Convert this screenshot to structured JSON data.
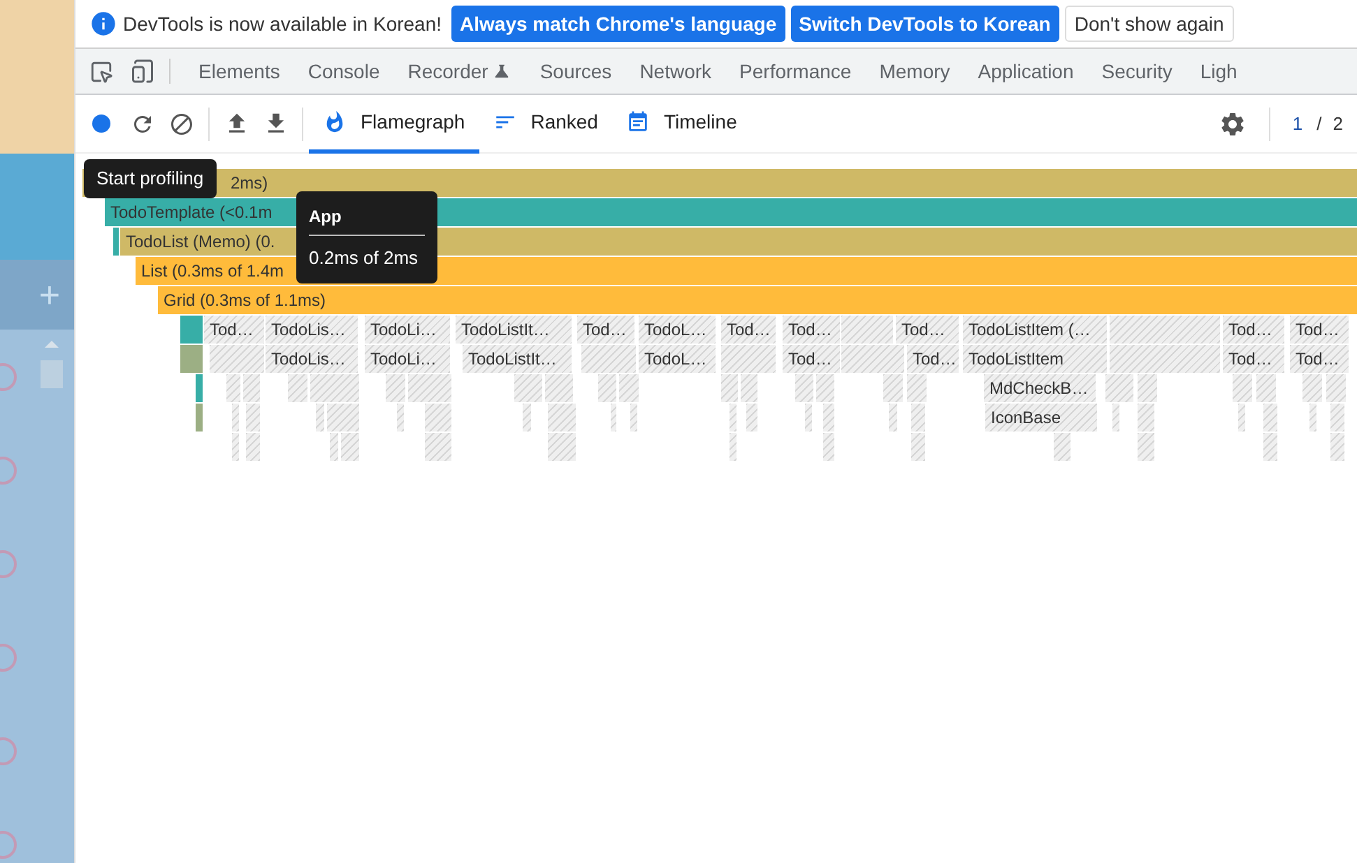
{
  "banner": {
    "message": "DevTools is now available in Korean!",
    "buttons": [
      {
        "label": "Always match Chrome's language",
        "kind": "primary"
      },
      {
        "label": "Switch DevTools to Korean",
        "kind": "primary"
      },
      {
        "label": "Don't show again",
        "kind": "secondary"
      }
    ]
  },
  "devtools_tabs": [
    {
      "label": "Elements",
      "experimental": false
    },
    {
      "label": "Console",
      "experimental": false
    },
    {
      "label": "Recorder",
      "experimental": true
    },
    {
      "label": "Sources",
      "experimental": false
    },
    {
      "label": "Network",
      "experimental": false
    },
    {
      "label": "Performance",
      "experimental": false
    },
    {
      "label": "Memory",
      "experimental": false
    },
    {
      "label": "Application",
      "experimental": false
    },
    {
      "label": "Security",
      "experimental": false
    },
    {
      "label": "Ligh",
      "experimental": false
    }
  ],
  "profiler_toolbar": {
    "recording": false,
    "tabs": [
      {
        "label": "Flamegraph",
        "selected": true
      },
      {
        "label": "Ranked",
        "selected": false
      },
      {
        "label": "Timeline",
        "selected": false
      }
    ],
    "commit_index": "1",
    "commit_separator": "/",
    "commit_total": "2"
  },
  "page_sidebar": {
    "add_label": "+"
  },
  "flamegraph": {
    "rows": [
      {
        "nodes": [
          {
            "label": "2ms)",
            "color": "#cfb966"
          }
        ]
      },
      {
        "nodes": [
          {
            "label": "TodoTemplate (<0.1m",
            "color": "#37aea7"
          }
        ]
      },
      {
        "nodes": [
          {
            "color": "#37aea7"
          },
          {
            "label": "TodoList (Memo) (0.",
            "color": "#cfb966"
          }
        ]
      },
      {
        "nodes": [
          {
            "label": "List (0.3ms of 1.4m",
            "color": "#ffbb3b"
          }
        ]
      },
      {
        "nodes": [
          {
            "label": "Grid (0.3ms of 1.1ms)",
            "color": "#ffbb3b"
          }
        ]
      },
      {
        "nodes": [
          {
            "color": "#37aea7"
          },
          {
            "label": "Tod…",
            "color": "#eeeeee"
          },
          {
            "label": "TodoLis…",
            "color": "#eeeeee"
          },
          {
            "label": "TodoLi…",
            "color": "#eeeeee"
          },
          {
            "label": "TodoListIt…",
            "color": "#eeeeee"
          },
          {
            "label": "Tod…",
            "color": "#eeeeee"
          },
          {
            "label": "TodoL…",
            "color": "#eeeeee"
          },
          {
            "label": "Tod…",
            "color": "#eeeeee"
          },
          {
            "label": "Tod…",
            "color": "#eeeeee"
          },
          {
            "label": "Tod…",
            "color": "#eeeeee"
          },
          {
            "label": "TodoListItem (…",
            "color": "#eeeeee"
          },
          {
            "label": "Tod…",
            "color": "#eeeeee"
          },
          {
            "label": "Tod…",
            "color": "#eeeeee"
          }
        ]
      },
      {
        "nodes": [
          {
            "color": "#9caf84"
          },
          {
            "label": "TodoLis…",
            "color": "#eeeeee"
          },
          {
            "label": "TodoLi…",
            "color": "#eeeeee"
          },
          {
            "label": "TodoListIt…",
            "color": "#eeeeee"
          },
          {
            "label": "TodoL…",
            "color": "#eeeeee"
          },
          {
            "label": "Tod…",
            "color": "#eeeeee"
          },
          {
            "label": "Tod…",
            "color": "#eeeeee"
          },
          {
            "label": "TodoListItem",
            "color": "#eeeeee"
          },
          {
            "label": "Tod…",
            "color": "#eeeeee"
          },
          {
            "label": "Tod…",
            "color": "#eeeeee"
          }
        ]
      },
      {
        "nodes": [
          {
            "color": "#37aea7"
          },
          {
            "label": "MdCheckB…",
            "color": "#eeeeee"
          }
        ]
      },
      {
        "nodes": [
          {
            "color": "#9caf84"
          },
          {
            "label": "IconBase",
            "color": "#eeeeee"
          }
        ]
      }
    ]
  },
  "tooltips": [
    {
      "kind": "hint",
      "text": "Start profiling"
    },
    {
      "kind": "detail",
      "title": "App",
      "text": "0.2ms of 2ms"
    }
  ]
}
